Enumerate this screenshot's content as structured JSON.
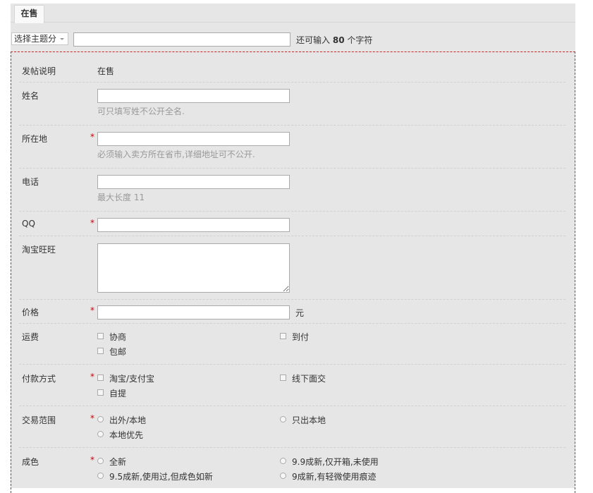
{
  "tab": {
    "label": "在售"
  },
  "subject": {
    "select_label": "选择主题分",
    "input_value": "",
    "hint_prefix": "还可输入",
    "hint_count": "80",
    "hint_suffix": "个字符"
  },
  "form": {
    "notice_label": "发帖说明",
    "notice_value": "在售",
    "name_label": "姓名",
    "name_help": "可只填写姓不公开全名.",
    "location_label": "所在地",
    "location_help": "必须输入卖方所在省市,详细地址可不公开.",
    "phone_label": "电话",
    "phone_help": "最大长度 11",
    "qq_label": "QQ",
    "wangwang_label": "淘宝旺旺",
    "price_label": "价格",
    "price_unit": "元",
    "shipping_label": "运费",
    "shipping_options": [
      "协商",
      "到付",
      "包邮"
    ],
    "payment_label": "付款方式",
    "payment_options": [
      "淘宝/支付宝",
      "线下面交",
      "自提"
    ],
    "scope_label": "交易范围",
    "scope_options": [
      "出外/本地",
      "只出本地",
      "本地优先"
    ],
    "condition_label": "成色",
    "condition_options": [
      "全新",
      "9.9成新,仅开箱,未使用",
      "9.5成新,使用过,但成色如新",
      "9成新,有轻微使用痕迹"
    ],
    "required_mark": "*"
  }
}
